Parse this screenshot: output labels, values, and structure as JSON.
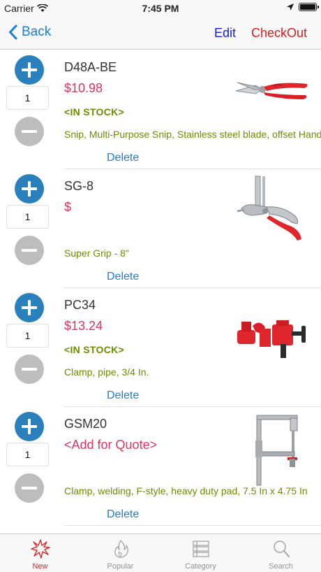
{
  "status_bar": {
    "carrier": "Carrier",
    "time": "7:45 PM"
  },
  "nav": {
    "back_label": "Back",
    "edit_label": "Edit",
    "checkout_label": "CheckOut"
  },
  "items": [
    {
      "sku": "D48A-BE",
      "price": "$10.98",
      "stock": "<IN STOCK>",
      "description": "Snip, Multi-Purpose Snip, Stainless steel blade, offset Handle",
      "quantity": "1",
      "delete_label": "Delete"
    },
    {
      "sku": "SG-8",
      "price": "$",
      "stock": "",
      "description": "Super Grip - 8\"",
      "quantity": "1",
      "delete_label": "Delete"
    },
    {
      "sku": "PC34",
      "price": "$13.24",
      "stock": "<IN STOCK>",
      "description": "Clamp, pipe, 3/4 In.",
      "quantity": "1",
      "delete_label": "Delete"
    },
    {
      "sku": "GSM20",
      "price": "<Add for Quote>",
      "stock": "",
      "description": "Clamp, welding, F-style, heavy duty pad, 7.5 In  x 4.75 In",
      "quantity": "1",
      "delete_label": "Delete"
    }
  ],
  "tabs": [
    {
      "label": "New",
      "icon": "burst-icon",
      "active": true
    },
    {
      "label": "Popular",
      "icon": "flame-icon",
      "active": false
    },
    {
      "label": "Category",
      "icon": "list-icon",
      "active": false
    },
    {
      "label": "Search",
      "icon": "search-icon",
      "active": false
    }
  ],
  "colors": {
    "accent": "#1a7ee0",
    "price": "#e0335e",
    "stock": "#6b8e00",
    "checkout": "#e11a1a"
  }
}
